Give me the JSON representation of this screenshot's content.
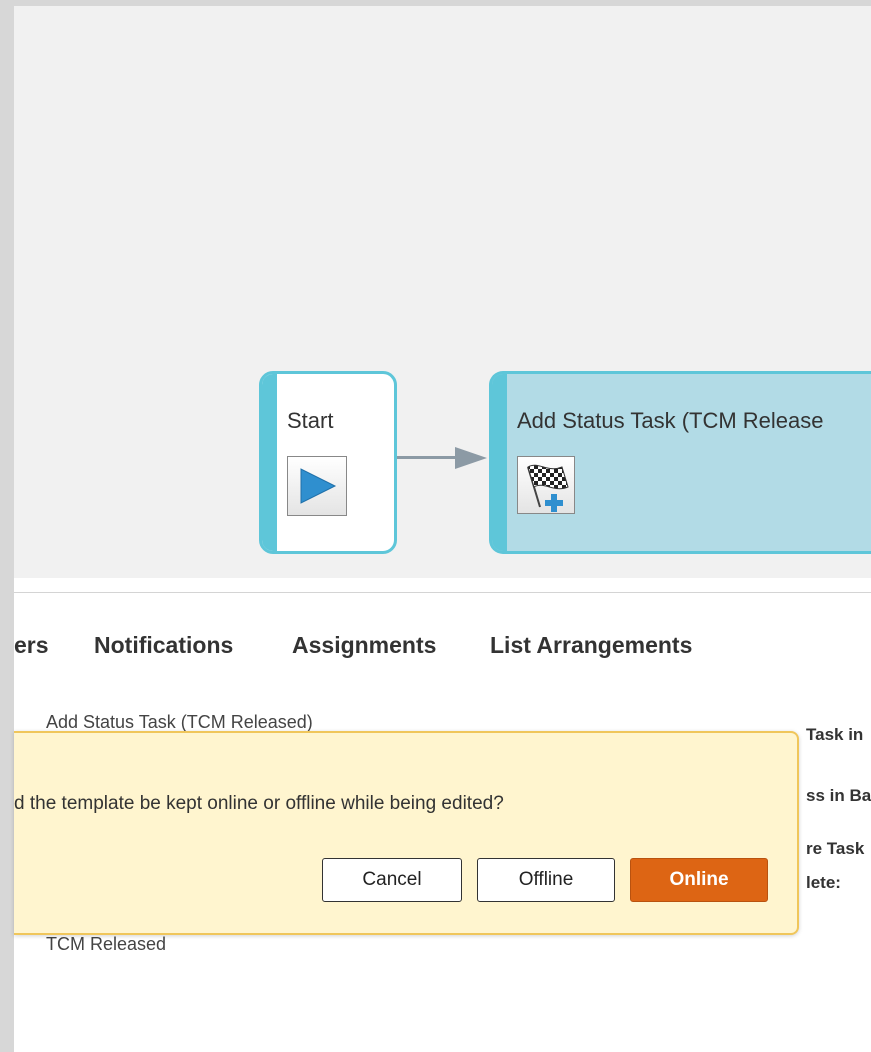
{
  "workflow": {
    "start_node": {
      "title": "Start",
      "icon": "play-icon"
    },
    "task_node": {
      "title": "Add Status Task (TCM Release",
      "icon": "checkered-flag-add-icon"
    }
  },
  "tabs": [
    {
      "label": "ers"
    },
    {
      "label": "Notifications"
    },
    {
      "label": "Assignments"
    },
    {
      "label": "List Arrangements"
    }
  ],
  "panel": {
    "task_name": "Add Status Task (TCM Released)",
    "status_value": "TCM Released",
    "right_labels": [
      "Task in",
      "ss in Ba",
      "re Task",
      "lete:"
    ]
  },
  "dialog": {
    "message": "d the template be kept online or offline while being edited?",
    "buttons": {
      "cancel": "Cancel",
      "offline": "Offline",
      "online": "Online"
    }
  },
  "colors": {
    "node_border": "#5ec6d9",
    "task_fill": "#b2dbe6",
    "dialog_bg": "#fff5cf",
    "dialog_border": "#f0c65b",
    "primary_button": "#dd6514"
  }
}
